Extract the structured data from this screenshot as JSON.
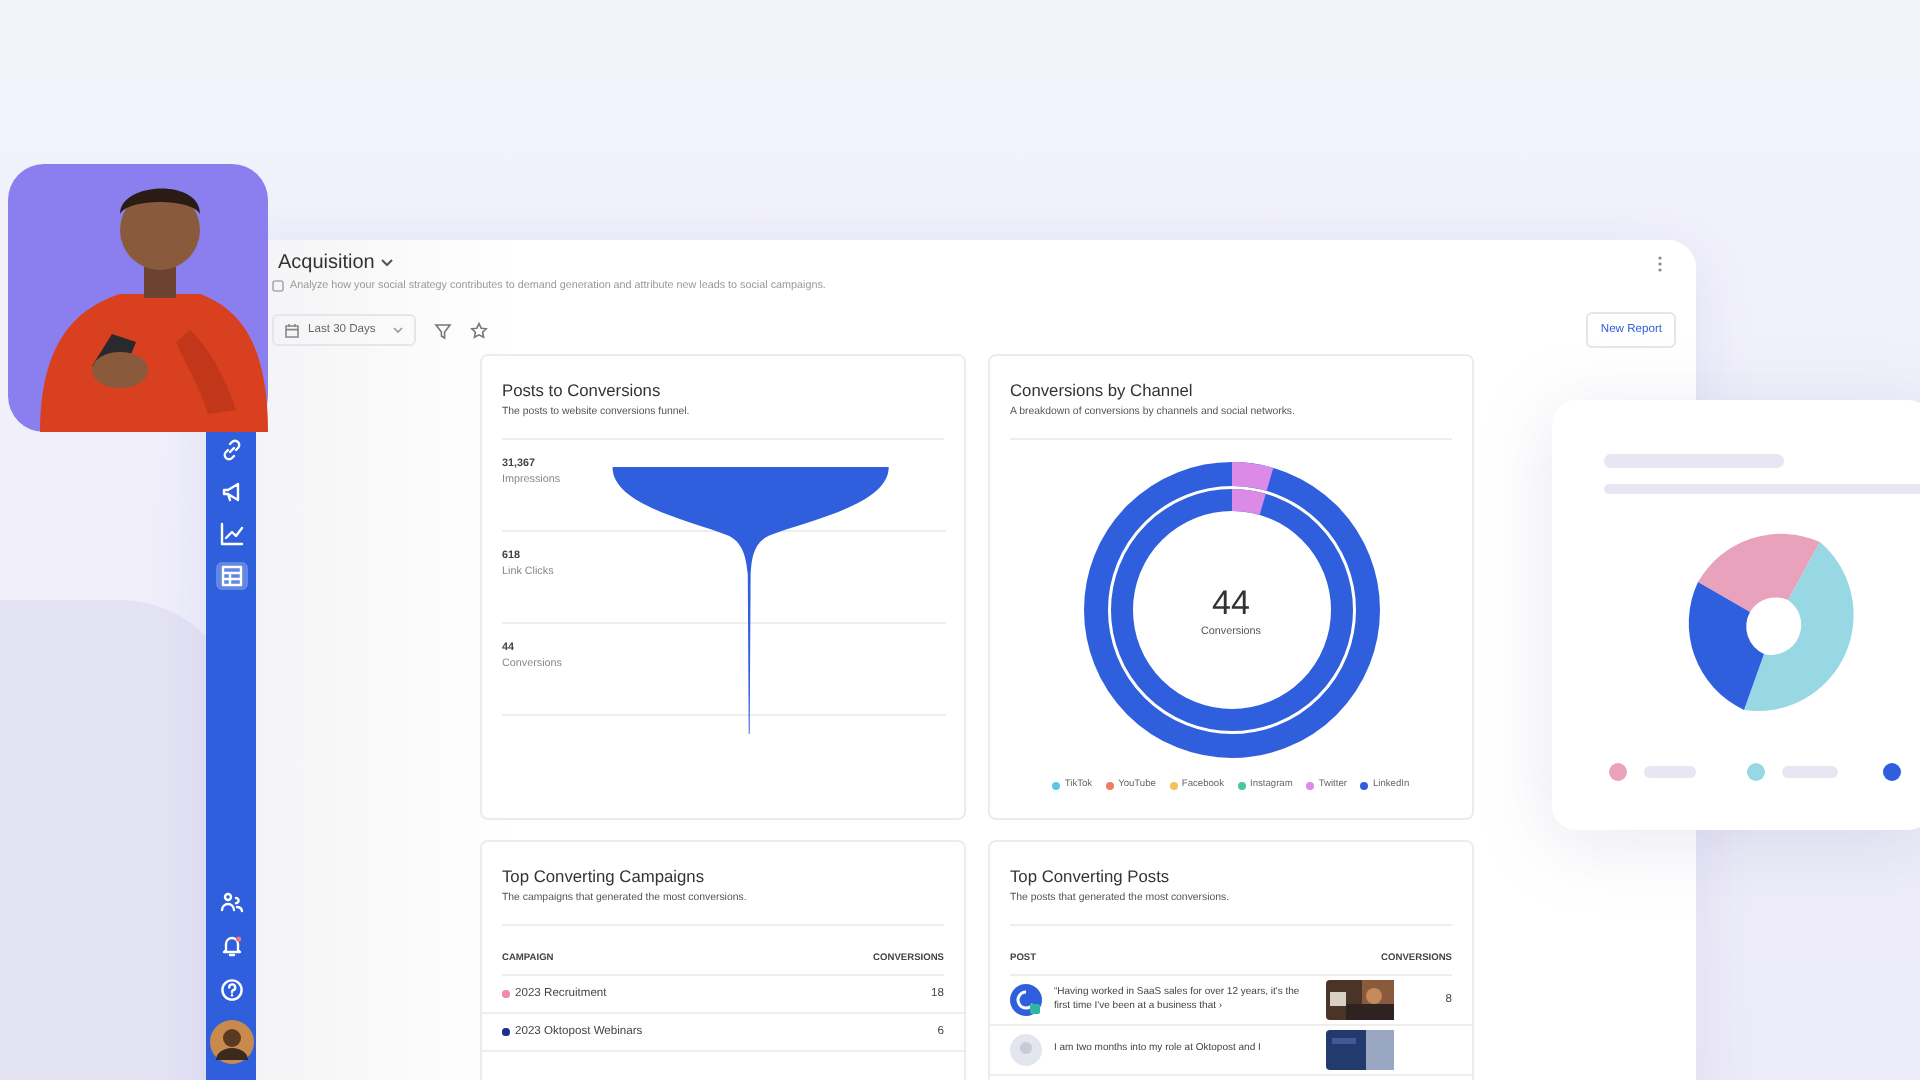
{
  "sidebar": {
    "items": [
      {
        "selected": false
      },
      {
        "selected": false
      },
      {
        "selected": false
      },
      {
        "selected": true
      }
    ],
    "bottom_items": [
      {
        "selected": false
      },
      {
        "selected": false
      },
      {
        "selected": false
      }
    ]
  },
  "header": {
    "title": "Acquisition",
    "description": "Analyze how your social strategy contributes to demand generation and attribute new leads to social campaigns.",
    "date_filter": "Last 30 Days",
    "button": "New Report"
  },
  "funnel_card": {
    "title": "Posts to Conversions",
    "subtitle": "The posts to website conversions funnel.",
    "stages": [
      {
        "value": "31,367",
        "label": "Impressions"
      },
      {
        "value": "618",
        "label": "Link Clicks"
      },
      {
        "value": "44",
        "label": "Conversions"
      }
    ]
  },
  "channel_card": {
    "title": "Conversions by Channel",
    "subtitle": "A breakdown of conversions by channels and social networks.",
    "total": "44",
    "total_label": "Conversions",
    "legend": [
      {
        "label": "TikTok",
        "color": "#5bc8ea"
      },
      {
        "label": "YouTube",
        "color": "#ee7b63"
      },
      {
        "label": "Facebook",
        "color": "#f4c25a"
      },
      {
        "label": "Instagram",
        "color": "#4cc69a"
      },
      {
        "label": "Twitter",
        "color": "#dc8ae8"
      },
      {
        "label": "LinkedIn",
        "color": "#2f5fdc"
      }
    ]
  },
  "campaigns_card": {
    "title": "Top Converting Campaigns",
    "subtitle": "The campaigns that generated the most conversions.",
    "columns": [
      "CAMPAIGN",
      "CONVERSIONS"
    ],
    "rows": [
      {
        "name": "2023 Recruitment",
        "color": "#f08bb0",
        "conversions": "18"
      },
      {
        "name": "2023 Oktopost Webinars",
        "color": "#1d2f8c",
        "conversions": "6"
      }
    ]
  },
  "posts_card": {
    "title": "Top Converting Posts",
    "subtitle": "The posts that generated the most conversions.",
    "columns": [
      "POST",
      "CONVERSIONS"
    ],
    "rows": [
      {
        "text": "“Having worked in SaaS sales for over 12 years, it's the first time I've been at a business that ›",
        "conversions": "8"
      },
      {
        "text": "I am two months into my role at Oktopost and I"
      }
    ]
  }
}
